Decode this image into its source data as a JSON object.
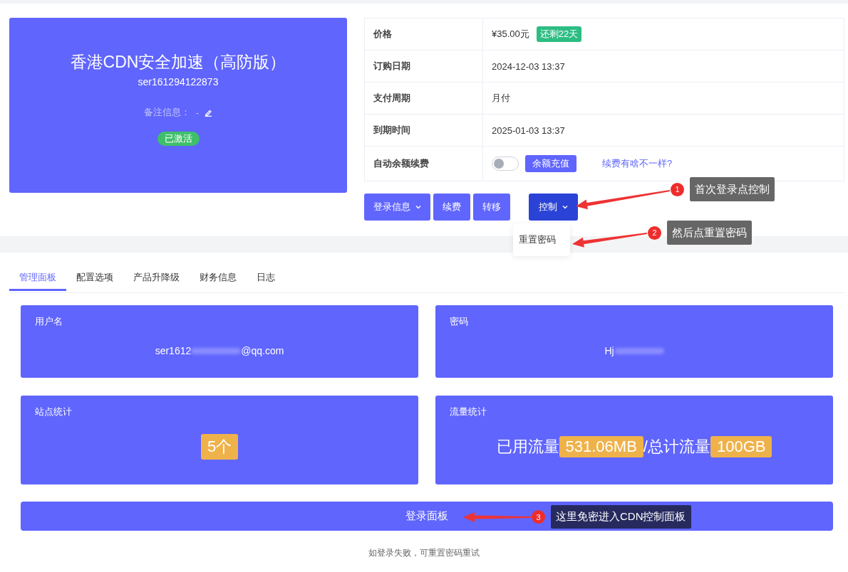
{
  "product": {
    "title": "香港CDN安全加速（高防版）",
    "service_id": "ser161294122873",
    "note_label": "备注信息：",
    "note_value": "-",
    "status": "已激活"
  },
  "details": [
    {
      "kind": "badge",
      "label": "价格",
      "value": "¥35.00元",
      "badge": "还剩22天"
    },
    {
      "kind": "text",
      "label": "订购日期",
      "value": "2024-12-03 13:37"
    },
    {
      "kind": "text",
      "label": "支付周期",
      "value": "月付"
    },
    {
      "kind": "text",
      "label": "到期时间",
      "value": "2025-01-03 13:37"
    },
    {
      "kind": "toggle",
      "label": "自动余额续费",
      "on": false,
      "button": "余额充值",
      "link": "续费有啥不一样?"
    }
  ],
  "actions": [
    {
      "label": "登录信息",
      "dropdown": true,
      "selected": false
    },
    {
      "label": "续费",
      "dropdown": false,
      "selected": false
    },
    {
      "label": "转移",
      "dropdown": false,
      "selected": false
    },
    {
      "label": "控制",
      "dropdown": true,
      "selected": true
    }
  ],
  "dropdown_menu": [
    "重置密码"
  ],
  "tabs": [
    {
      "label": "管理面板",
      "selected": true
    },
    {
      "label": "配置选项",
      "selected": false
    },
    {
      "label": "产品升降级",
      "selected": false
    },
    {
      "label": "财务信息",
      "selected": false
    },
    {
      "label": "日志",
      "selected": false
    }
  ],
  "cards": [
    {
      "kind": "masked",
      "title": "用户名",
      "value_start": "ser1612",
      "value_end": "@qq.com"
    },
    {
      "kind": "masked",
      "title": "密码",
      "value_start": "Hj"
    },
    {
      "kind": "count",
      "title": "站点统计",
      "value": "5个"
    },
    {
      "kind": "traffic",
      "title": "流量统计",
      "used_label": "已用流量",
      "used": "531.06MB",
      "total_label": "/总计流量",
      "total": "100GB"
    }
  ],
  "login_button": "登录面板",
  "footer_note": "如登录失败，可重置密码重试",
  "annotations": [
    {
      "number": "1",
      "text": "首次登录点控制",
      "color": "#666666"
    },
    {
      "number": "2",
      "text": "然后点重置密码",
      "color": "#666666"
    },
    {
      "number": "3",
      "text": "这里免密进入CDN控制面板",
      "color": "#262a5e"
    }
  ]
}
